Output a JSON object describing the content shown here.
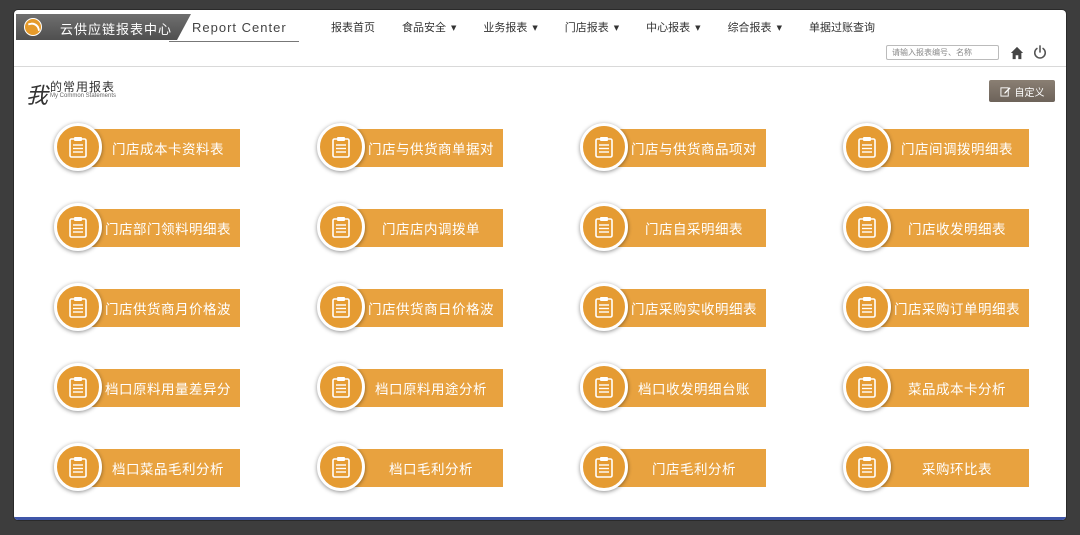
{
  "header": {
    "brand_title": "云供应链报表中心",
    "brand_subtitle": "Report Center",
    "nav": [
      {
        "label": "报表首页",
        "dropdown": false
      },
      {
        "label": "食品安全",
        "dropdown": true
      },
      {
        "label": "业务报表",
        "dropdown": true
      },
      {
        "label": "门店报表",
        "dropdown": true
      },
      {
        "label": "中心报表",
        "dropdown": true
      },
      {
        "label": "综合报表",
        "dropdown": true
      },
      {
        "label": "单据过账查询",
        "dropdown": false
      }
    ],
    "search_placeholder": "请输入报表编号、名称"
  },
  "section": {
    "title_big": "我",
    "title_small": "的常用报表",
    "title_en": "My Common Statements",
    "custom_label": "自定义"
  },
  "reports": [
    "门店成本卡资料表",
    "门店与供货商单据对",
    "门店与供货商品项对",
    "门店间调拨明细表",
    "门店部门领料明细表",
    "门店店内调拨单",
    "门店自采明细表",
    "门店收发明细表",
    "门店供货商月价格波",
    "门店供货商日价格波",
    "门店采购实收明细表",
    "门店采购订单明细表",
    "档口原料用量差异分",
    "档口原料用途分析",
    "档口收发明细台账",
    "菜品成本卡分析",
    "档口菜品毛利分析",
    "档口毛利分析",
    "门店毛利分析",
    "采购环比表"
  ],
  "colors": {
    "accent": "#e8a23f",
    "brand_bg": "#5a5a5a",
    "custom_btn": "#7b7167"
  }
}
